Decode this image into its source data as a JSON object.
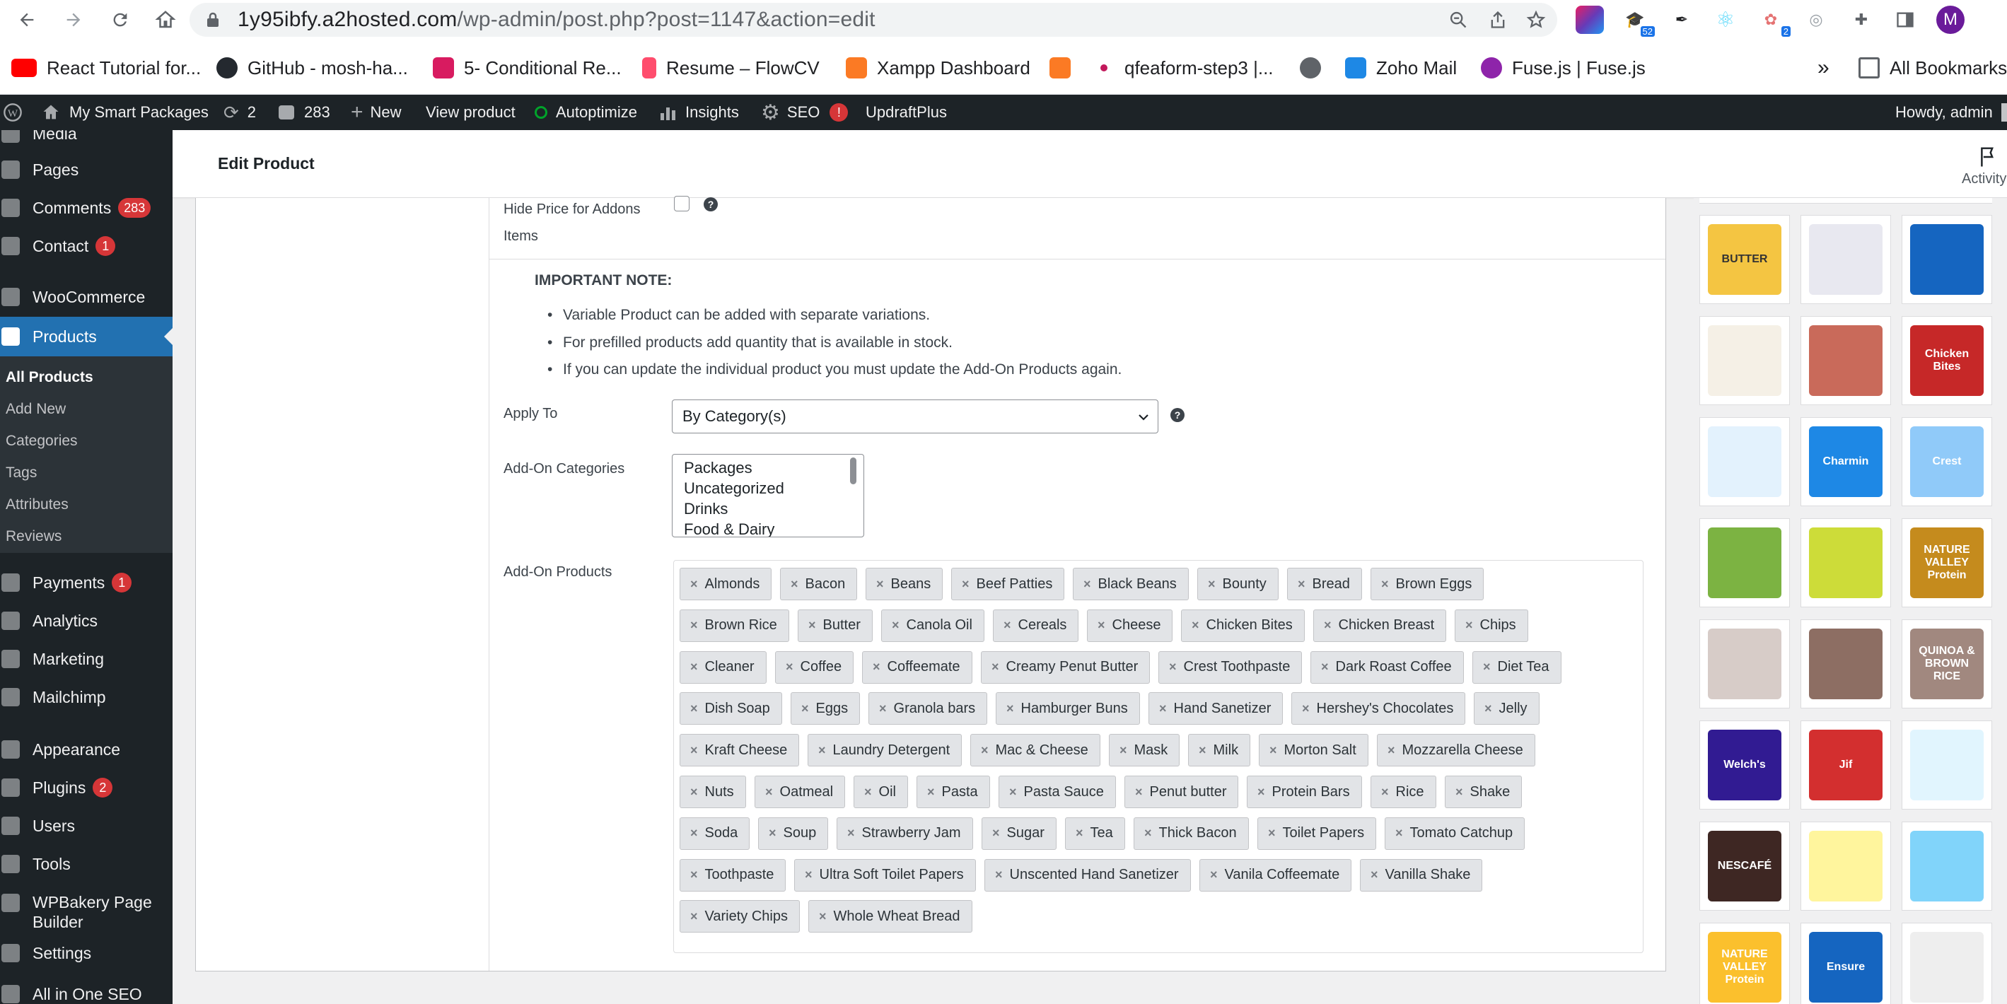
{
  "browser": {
    "url_host": "1y95ibfy.a2hosted.com",
    "url_path": "/wp-admin/post.php?post=1147&action=edit",
    "ext_badge_1": "52",
    "ext_badge_2": "2",
    "profile_initial": "M"
  },
  "bookmarks": {
    "items": [
      {
        "label": "React Tutorial for..."
      },
      {
        "label": "GitHub - mosh-ha..."
      },
      {
        "label": "5- Conditional Re..."
      },
      {
        "label": "Resume – FlowCV"
      },
      {
        "label": "Xampp Dashboard"
      },
      {
        "label": "qfeaform-step3 |..."
      },
      {
        "label": "Zoho Mail"
      },
      {
        "label": "Fuse.js | Fuse.js"
      }
    ],
    "overflow": "»",
    "all_bookmarks": "All Bookmarks"
  },
  "adminbar": {
    "site": "My Smart Packages",
    "updates": "2",
    "comments": "283",
    "new": "New",
    "view_product": "View product",
    "autoptimize": "Autoptimize",
    "insights": "Insights",
    "seo": "SEO",
    "seo_badge": "!",
    "updraft": "UpdraftPlus",
    "howdy": "Howdy, admin"
  },
  "sidebar": {
    "media_partial": "Media",
    "pages": "Pages",
    "comments": "Comments",
    "comments_badge": "283",
    "contact": "Contact",
    "contact_badge": "1",
    "woocommerce": "WooCommerce",
    "products": "Products",
    "sub": [
      "All Products",
      "Add New",
      "Categories",
      "Tags",
      "Attributes",
      "Reviews"
    ],
    "payments": "Payments",
    "payments_badge": "1",
    "analytics": "Analytics",
    "marketing": "Marketing",
    "mailchimp": "Mailchimp",
    "appearance": "Appearance",
    "plugins": "Plugins",
    "plugins_badge": "2",
    "users": "Users",
    "tools": "Tools",
    "wpbakery_1": "WPBakery Page",
    "wpbakery_2": "Builder",
    "settings": "Settings",
    "aioseo": "All in One SEO"
  },
  "header": {
    "title": "Edit Product",
    "activity": "Activity"
  },
  "form": {
    "hide_price_1": "Hide Price for Addons",
    "hide_price_2": "Items",
    "important_note": "IMPORTANT NOTE:",
    "notes": [
      "Variable Product can be added with separate variations.",
      "For prefilled products add quantity that is available in stock.",
      "If you can update the individual product you must update the Add-On Products again."
    ],
    "apply_to_label": "Apply To",
    "apply_to_value": "By Category(s)",
    "addon_categories_label": "Add-On Categories",
    "addon_categories": [
      "Packages",
      "Uncategorized",
      "Drinks",
      "Food & Dairy"
    ],
    "addon_products_label": "Add-On Products",
    "addon_products": [
      [
        "Almonds",
        "Bacon",
        "Beans",
        "Beef Patties",
        "Black Beans",
        "Bounty",
        "Bread",
        "Brown Eggs"
      ],
      [
        "Brown Rice",
        "Butter",
        "Canola Oil",
        "Cereals",
        "Cheese",
        "Chicken Bites",
        "Chicken Breast",
        "Chips"
      ],
      [
        "Cleaner",
        "Coffee",
        "Coffeemate",
        "Creamy Penut Butter",
        "Crest Toothpaste",
        "Dark Roast Coffee",
        "Diet Tea"
      ],
      [
        "Dish Soap",
        "Eggs",
        "Granola bars",
        "Hamburger Buns",
        "Hand Sanetizer",
        "Hershey's Chocolates",
        "Jelly"
      ],
      [
        "Kraft Cheese",
        "Laundry Detergent",
        "Mac & Cheese",
        "Mask",
        "Milk",
        "Morton Salt",
        "Mozzarella Cheese"
      ],
      [
        "Nuts",
        "Oatmeal",
        "Oil",
        "Pasta",
        "Pasta Sauce",
        "Penut butter",
        "Protein Bars",
        "Rice",
        "Shake"
      ],
      [
        "Soda",
        "Soup",
        "Strawberry Jam",
        "Sugar",
        "Tea",
        "Thick Bacon",
        "Toilet Papers",
        "Tomato Catchup"
      ],
      [
        "Toothpaste",
        "Ultra Soft Toilet Papers",
        "Unscented Hand Sanetizer",
        "Vanila Coffeemate",
        "Vanilla Shake"
      ],
      [
        "Variety Chips",
        "Whole Wheat Bread"
      ]
    ],
    "chip_remove": "×"
  },
  "gallery": {
    "labels": [
      "BUTTER",
      "",
      "",
      "",
      "",
      "Chicken Bites",
      "",
      "Charmin",
      "Crest",
      "",
      "",
      "NATURE VALLEY Protein",
      "",
      "",
      "QUINOA & BROWN RICE",
      "Welch's",
      "Jif",
      "",
      "NESCAFÉ",
      "",
      "",
      "NATURE VALLEY Protein",
      "Ensure",
      ""
    ]
  }
}
